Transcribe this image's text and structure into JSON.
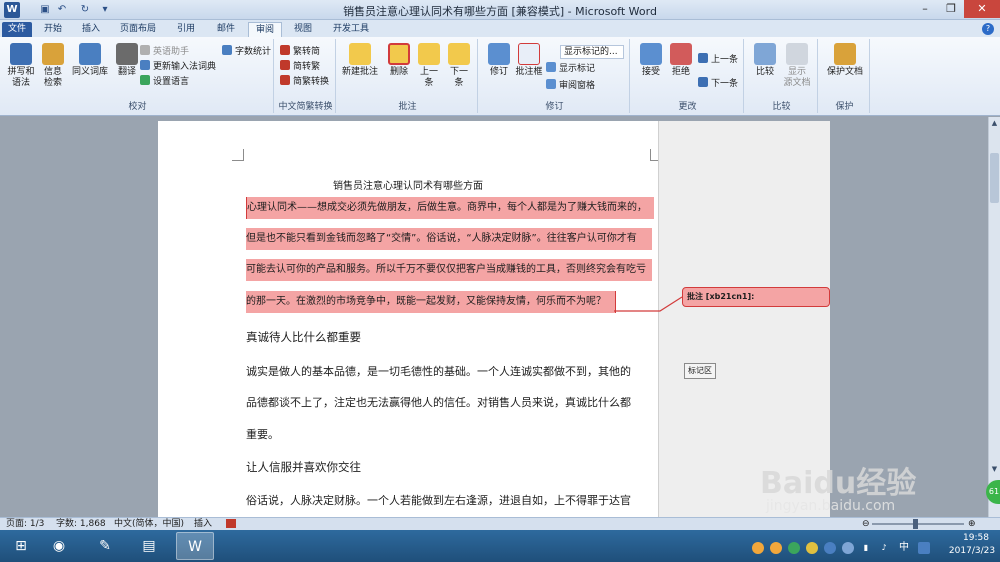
{
  "window": {
    "title": "销售员注意心理认同术有哪些方面 [兼容模式] - Microsoft Word",
    "app_logo": "W",
    "controls": [
      "–",
      "❐",
      "✕"
    ]
  },
  "tabs": [
    {
      "label": "文件"
    },
    {
      "label": "开始"
    },
    {
      "label": "插入"
    },
    {
      "label": "页面布局"
    },
    {
      "label": "引用"
    },
    {
      "label": "邮件"
    },
    {
      "label": "审阅"
    },
    {
      "label": "视图"
    },
    {
      "label": "开发工具"
    }
  ],
  "ribbon": {
    "proofing": {
      "label": "校对",
      "spelling": "拼写和\n语法",
      "research": "信息\n检索",
      "thesaurus": "同义词库",
      "translate": "翻译",
      "english_assistant": "英语助手",
      "update_ime": "更新输入法词典",
      "set_language": "设置语言",
      "word_count": "字数统计"
    },
    "chinese": {
      "label": "中文简繁转换",
      "to_simplified": "繁转简",
      "to_traditional": "简转繁",
      "convert": "简繁转换"
    },
    "comments": {
      "label": "批注",
      "new": "新建批注",
      "delete": "删除",
      "prev": "上一\n条",
      "next": "下一\n条"
    },
    "tracking": {
      "label": "修订",
      "track": "修订",
      "balloons": "批注框",
      "display_for_review": "显示标记的...",
      "show_markup": "显示标记",
      "reviewing_pane": "审阅窗格"
    },
    "changes": {
      "label": "更改",
      "accept": "接受",
      "reject": "拒绝",
      "previous": "上一条",
      "next": "下一条"
    },
    "compare": {
      "label": "比较",
      "compare": "比较",
      "show_source": "显示\n源文档"
    },
    "protect": {
      "label": "保护",
      "protect_doc": "保护文档"
    }
  },
  "document": {
    "title": "销售员注意心理认同术有哪些方面",
    "highlighted_lines": [
      "心理认同术——想成交必须先做朋友，后做生意。商界中，每个人都是为了赚大钱而来的，",
      "但是也不能只看到金钱而忽略了“交情”。俗话说，“人脉决定财脉”。往往客户认可你才有",
      "可能去认可你的产品和服务。所以千万不要仅仅把客户当成赚钱的工具，否则终究会有吃亏",
      "的那一天。在激烈的市场竞争中，既能一起发财，又能保持友情，何乐而不为呢？"
    ],
    "heading1": "真诚待人比什么都重要",
    "para1_lines": [
      "诚实是做人的基本品德，是一切毛德性的基础。一个人连诚实都做不到，其他的",
      "品德都谈不上了，注定也无法赢得他人的信任。对销售人员来说，真诚比什么都",
      "重要。"
    ],
    "heading2": "让人信服并喜欢你交往",
    "para2_line": "俗话说，人脉决定财脉。一个人若能做到左右逢源，进退自如，上不得罪于达官"
  },
  "comment": {
    "text": "批注 [xb21cn1]:"
  },
  "markup_area": {
    "label": "标记区"
  },
  "statusbar": {
    "page": "页面: 1/3",
    "words": "字数: 1,868",
    "language": "中文(简体，中国)",
    "insert_mode": "插入",
    "zoom_minus": "⊖",
    "zoom_plus": "⊕",
    "zoom_level": 0.47
  },
  "taskbar": {
    "time": "19:58",
    "date": "2017/3/23",
    "ime": "中",
    "badge": "61"
  },
  "watermark": {
    "logo": "Baidu经验",
    "url": "jingyan.baidu.com"
  },
  "colors": {
    "highlight": "#f4a4a4",
    "comment_border": "#d23b3b",
    "file_tab": "#2c5aa0",
    "taskbar": "#2e6a9e"
  }
}
